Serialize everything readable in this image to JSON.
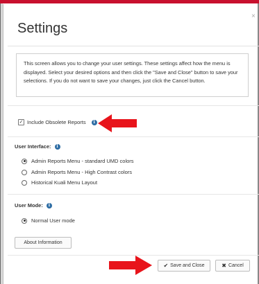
{
  "dialog": {
    "title": "Settings",
    "close_glyph": "×",
    "info_text": "This screen allows you to change your user settings. These settings affect how the menu is displayed. Select your desired options and then click the \"Save and Close\" button to save your selections. If you do not want to save your changes, just click the Cancel button."
  },
  "obsolete": {
    "label": "Include Obsolete Reports",
    "checked": true,
    "check_glyph": "✓",
    "info_glyph": "i"
  },
  "user_interface": {
    "label": "User Interface:",
    "options": [
      {
        "label": "Admin Reports Menu - standard UMD colors",
        "selected": true
      },
      {
        "label": "Admin Reports Menu - High Contrast colors",
        "selected": false
      },
      {
        "label": "Historical Kuali Menu Layout",
        "selected": false
      }
    ]
  },
  "user_mode": {
    "label": "User Mode:",
    "options": [
      {
        "label": "Normal User mode",
        "selected": true
      }
    ]
  },
  "buttons": {
    "about": "About Information",
    "save": "Save and Close",
    "save_icon": "✔",
    "cancel": "Cancel",
    "cancel_icon": "✖"
  },
  "colors": {
    "accent_bar": "#c8102e",
    "info_icon": "#2e6da4",
    "annotation_arrow": "#e8141b"
  },
  "icons": [
    "info-icon",
    "check-icon",
    "close-icon",
    "arrow-annotation-icon"
  ]
}
